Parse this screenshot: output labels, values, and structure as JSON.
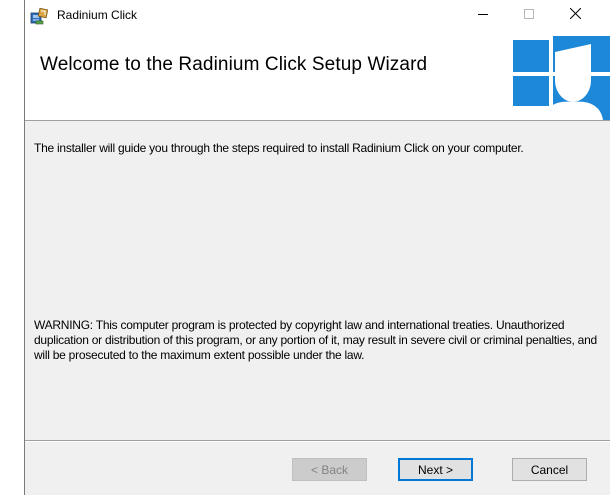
{
  "window": {
    "title": "Radinium Click",
    "controls": {
      "minimize_icon": "minimize-icon",
      "maximize_icon": "maximize-icon",
      "close_icon": "close-icon"
    }
  },
  "header": {
    "title": "Welcome to the Radinium Click Setup Wizard",
    "banner_icon": "windows-user-banner-icon",
    "banner_color": "#1e88d8"
  },
  "content": {
    "intro": "The installer will guide you through the steps required to install Radinium Click on your computer.",
    "warning": "WARNING: This computer program is protected by copyright law and international treaties. Unauthorized duplication or distribution of this program, or any portion of it, may result in severe civil or criminal penalties, and will be prosecuted to the maximum extent possible under the law."
  },
  "buttons": {
    "back": "< Back",
    "next": "Next >",
    "cancel": "Cancel"
  },
  "colors": {
    "accent": "#0078d7",
    "dialog_background": "#f0f0f0"
  }
}
